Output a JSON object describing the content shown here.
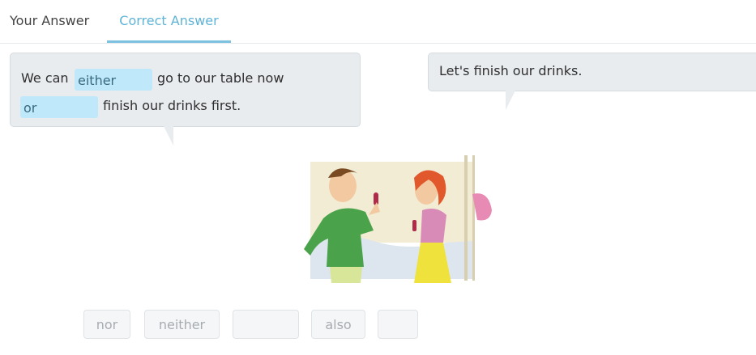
{
  "tabs": {
    "your_answer": "Your Answer",
    "correct_answer": "Correct Answer",
    "active": "Correct Answer"
  },
  "left_bubble": {
    "line1_prefix": "We can",
    "blank1": "either",
    "line1_suffix": "go to our table now",
    "blank2": "or",
    "line2_suffix": "finish our drinks first."
  },
  "right_bubble": {
    "text": "Let's finish our drinks."
  },
  "word_bank": [
    "nor",
    "neither",
    "",
    "also",
    ""
  ],
  "colors": {
    "accent": "#5fb3d6",
    "blank_fill": "#bfe8fb",
    "bubble_fill": "#e8ecef"
  }
}
